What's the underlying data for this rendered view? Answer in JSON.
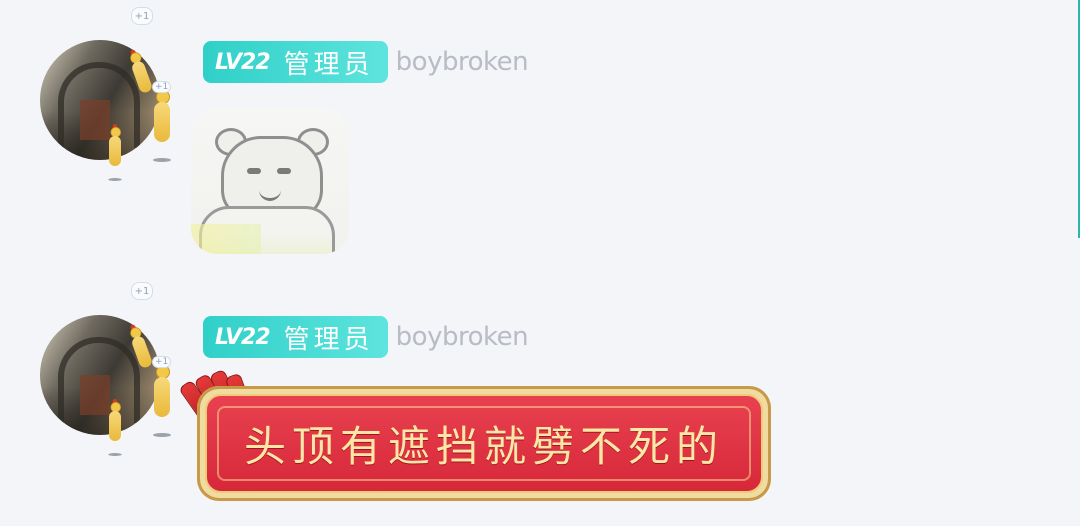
{
  "messages": [
    {
      "plus_badge": "+1",
      "avatar_badge": "+1",
      "level": "LV22",
      "role": "管理员",
      "username": "boybroken",
      "content_type": "sticker",
      "sticker_icon": "bear-meme-icon"
    },
    {
      "plus_badge": "+1",
      "avatar_badge": "+1",
      "level": "LV22",
      "role": "管理员",
      "username": "boybroken",
      "content_type": "text",
      "text": "头顶有遮挡就劈不死的"
    }
  ],
  "colors": {
    "background": "#f4f5f9",
    "level_badge": "#2fd0c8",
    "username": "#b8bcc4",
    "bubble_red": "#d7283a",
    "bubble_text": "#fde7a6"
  }
}
